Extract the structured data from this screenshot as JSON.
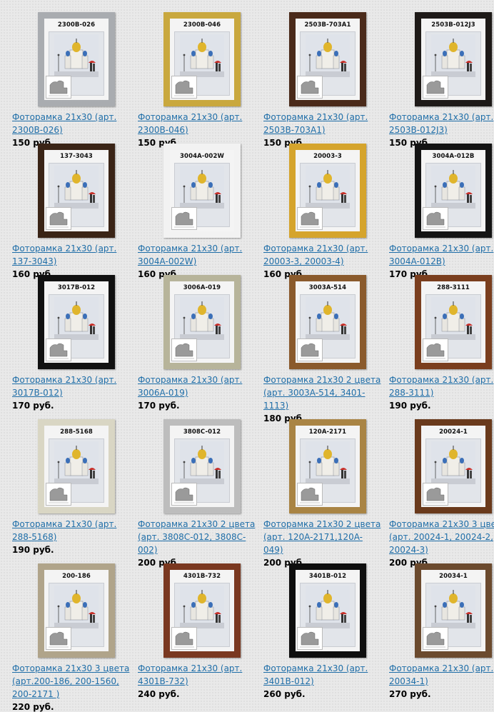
{
  "products": [
    {
      "code": "2300B-026",
      "title": "Фоторамка 21x30 (арт. 2300B-026)",
      "price": "150 руб.",
      "frame_color": "#a9acb0"
    },
    {
      "code": "2300B-046",
      "title": "Фоторамка 21x30 (арт. 2300B-046)",
      "price": "150 руб.",
      "frame_color": "#c9a83e"
    },
    {
      "code": "2503B-703A1",
      "title": "Фоторамка 21x30 (арт. 2503B-703A1)",
      "price": "150 руб.",
      "frame_color": "#4a2a1a"
    },
    {
      "code": "2503B-012J3",
      "title": "Фоторамка 21x30 (арт. 2503B-012J3)",
      "price": "150 руб.",
      "frame_color": "#1e1a18"
    },
    {
      "code": "137-3043",
      "title": "Фоторамка 21x30 (арт. 137-3043)",
      "price": "160 руб.",
      "frame_color": "#3a2416"
    },
    {
      "code": "3004A-002W",
      "title": "Фоторамка 21x30 (арт. 3004A-002W)",
      "price": "160 руб.",
      "frame_color": "#f2f2f2"
    },
    {
      "code": "20003-3",
      "title": "Фоторамка 21x30 (арт. 20003-3, 20003-4)",
      "price": "160 руб.",
      "frame_color": "#d5a42c"
    },
    {
      "code": "3004A-012B",
      "title": "Фоторамка 21x30 (арт. 3004A-012B)",
      "price": "170 руб.",
      "frame_color": "#141414"
    },
    {
      "code": "3017B-012",
      "title": "Фоторамка 21x30 (арт. 3017B-012)",
      "price": "170 руб.",
      "frame_color": "#111111"
    },
    {
      "code": "3006A-019",
      "title": "Фоторамка 21x30 (арт. 3006A-019)",
      "price": "170 руб.",
      "frame_color": "#b7b49a"
    },
    {
      "code": "3003A-514",
      "title": "Фоторамка 21x30 2 цвета (арт. 3003A-514, 3401-1113)",
      "price": "180 руб.",
      "frame_color": "#8a5a2c"
    },
    {
      "code": "288-3111",
      "title": "Фоторамка 21x30 (арт. 288-3111)",
      "price": "190 руб.",
      "frame_color": "#7a3e1e"
    },
    {
      "code": "288-5168",
      "title": "Фоторамка 21x30 (арт. 288-5168)",
      "price": "190 руб.",
      "frame_color": "#d9d6c4"
    },
    {
      "code": "3808C-012",
      "title": "Фоторамка 21x30 2 цвета (арт. 3808C-012, 3808C-002)",
      "price": "200 руб.",
      "frame_color": "#bdbdbd"
    },
    {
      "code": "120A-2171",
      "title": "Фоторамка 21x30 2 цвета (арт. 120A-2171,120A-049)",
      "price": "200 руб.",
      "frame_color": "#a98444"
    },
    {
      "code": "20024-1",
      "title": "Фоторамка 21x30 3 цвета (арт. 20024-1, 20024-2, 20024-3)",
      "price": "200 руб.",
      "frame_color": "#6a3a1c"
    },
    {
      "code": "200-186",
      "title": "Фоторамка 21x30 3 цвета (арт.200-186, 200-1560, 200-2171 )",
      "price": "220 руб.",
      "frame_color": "#b0a48a"
    },
    {
      "code": "4301B-732",
      "title": "Фоторамка 21x30 (арт. 4301B-732)",
      "price": "240 руб.",
      "frame_color": "#7a3820"
    },
    {
      "code": "3401B-012",
      "title": "Фоторамка 21x30 (арт. 3401B-012)",
      "price": "260 руб.",
      "frame_color": "#0e0e0e"
    },
    {
      "code": "20034-1",
      "title": "Фоторамка 21x30 (арт. 20034-1)",
      "price": "270 руб.",
      "frame_color": "#6b4a2e"
    }
  ]
}
